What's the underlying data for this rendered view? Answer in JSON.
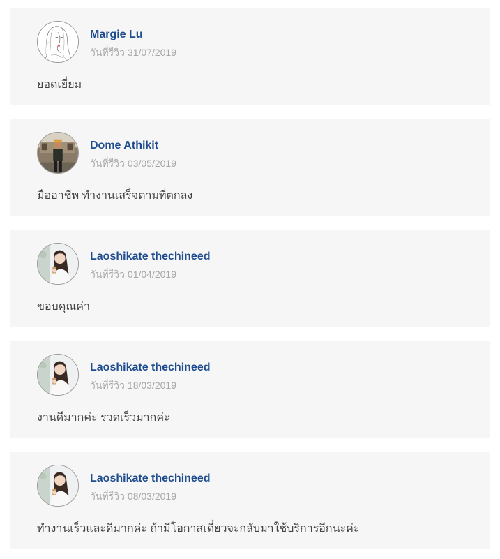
{
  "reviews": [
    {
      "name": "Margie Lu",
      "date_label": "วันที่รีวิว",
      "date": "31/07/2019",
      "text": "ยอดเยี่ยม",
      "avatar_icon": "sketch-portrait-avatar"
    },
    {
      "name": "Dome Athikit",
      "date_label": "วันที่รีวิว",
      "date": "03/05/2019",
      "text": "มืออาชีพ ทำงานเสร็จตามที่ตกลง",
      "avatar_icon": "photo-portrait-avatar"
    },
    {
      "name": "Laoshikate thechineed",
      "date_label": "วันที่รีวิว",
      "date": "01/04/2019",
      "text": "ขอบคุณค่า",
      "avatar_icon": "photo-portrait-avatar"
    },
    {
      "name": "Laoshikate thechineed",
      "date_label": "วันที่รีวิว",
      "date": "18/03/2019",
      "text": "งานดีมากค่ะ รวดเร็วมากค่ะ",
      "avatar_icon": "photo-portrait-avatar"
    },
    {
      "name": "Laoshikate thechineed",
      "date_label": "วันที่รีวิว",
      "date": "08/03/2019",
      "text": "ทำงานเร็วและดีมากค่ะ ถ้ามีโอกาสเดี๋ยวจะกลับมาใช้บริการอีกนะค่ะ",
      "avatar_icon": "photo-portrait-avatar"
    }
  ],
  "colors": {
    "card_background": "#f6f6f6",
    "name": "#1e4c8f",
    "date": "#a6a6a6",
    "text": "#444444"
  }
}
